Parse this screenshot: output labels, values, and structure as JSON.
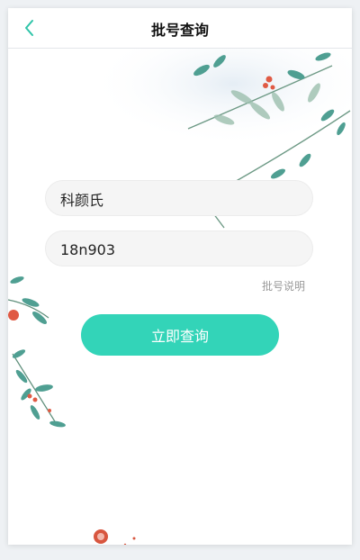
{
  "header": {
    "title": "批号查询",
    "back_icon": "chevron-left-icon"
  },
  "form": {
    "brand_value": "科颜氏",
    "batch_value": "18n903",
    "explain_link": "批号说明",
    "submit_label": "立即查询"
  },
  "colors": {
    "accent": "#33d4b8",
    "back_icon": "#2ec4a8",
    "leaf": "#5aa59a",
    "berry": "#e05a44"
  }
}
